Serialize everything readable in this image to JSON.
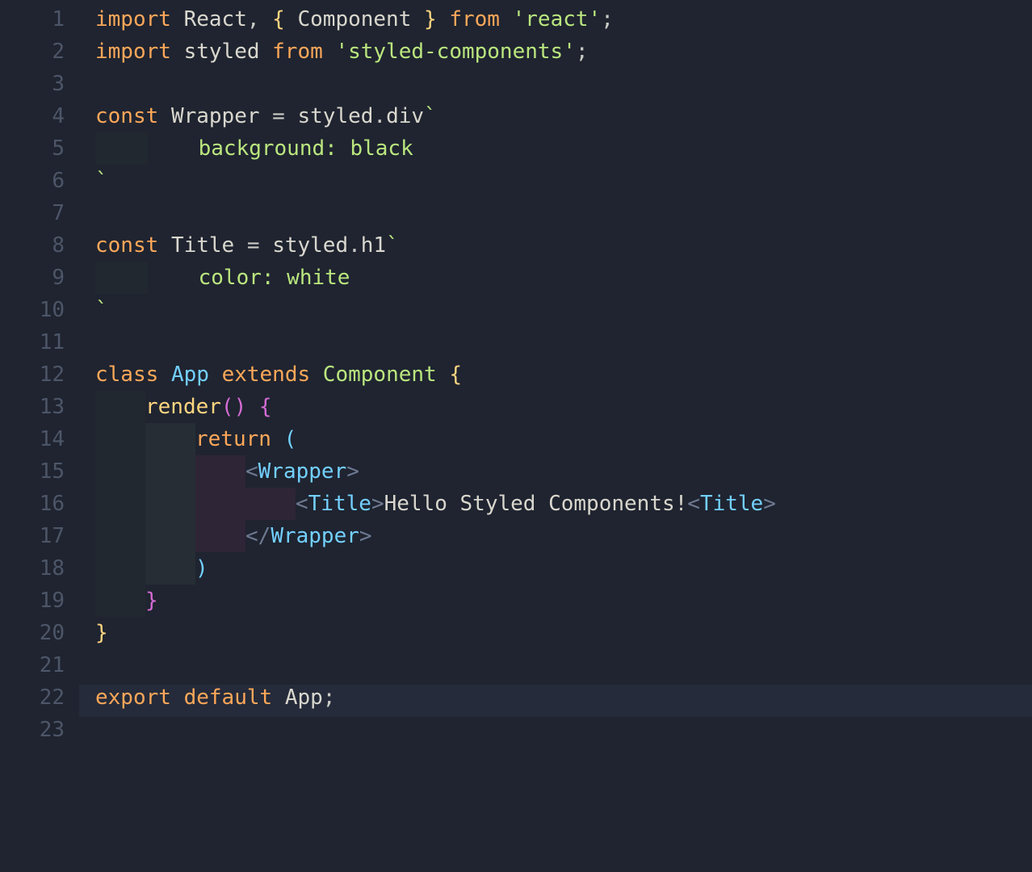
{
  "line_numbers": [
    "1",
    "2",
    "3",
    "4",
    "5",
    "6",
    "7",
    "8",
    "9",
    "10",
    "11",
    "12",
    "13",
    "14",
    "15",
    "16",
    "17",
    "18",
    "19",
    "20",
    "21",
    "22",
    "23"
  ],
  "tokens": {
    "l1": {
      "kw1": "import",
      "id1": "React",
      "punc1": ",",
      "brace1": "{",
      "id2": "Component",
      "brace2": "}",
      "kw2": "from",
      "str": "'react'",
      "semi": ";"
    },
    "l2": {
      "kw1": "import",
      "id1": "styled",
      "kw2": "from",
      "str": "'styled-components'",
      "semi": ";"
    },
    "l4": {
      "kw": "const",
      "id": "Wrapper",
      "eq": "=",
      "obj": "styled",
      "dot": ".",
      "prop": "div",
      "bt": "`"
    },
    "l5": {
      "body": "    background: black"
    },
    "l6": {
      "bt": "`"
    },
    "l8": {
      "kw": "const",
      "id": "Title",
      "eq": "=",
      "obj": "styled",
      "dot": ".",
      "prop": "h1",
      "bt": "`"
    },
    "l9": {
      "body": "    color: white"
    },
    "l10": {
      "bt": "`"
    },
    "l12": {
      "kw1": "class",
      "name": "App",
      "kw2": "extends",
      "sup": "Component",
      "brace": "{"
    },
    "l13": {
      "fn": "render",
      "paren": "()",
      "brace": "{"
    },
    "l14": {
      "kw": "return",
      "paren": "("
    },
    "l15": {
      "open": "<",
      "tag": "Wrapper",
      "close": ">"
    },
    "l16": {
      "open1": "<",
      "tag1": "Title",
      "close1": ">",
      "text": "Hello Styled Components!",
      "open2": "<",
      "tag2": "Title",
      "close2": ">"
    },
    "l17": {
      "open": "</",
      "tag": "Wrapper",
      "close": ">"
    },
    "l18": {
      "paren": ")"
    },
    "l19": {
      "brace": "}"
    },
    "l20": {
      "brace": "}"
    },
    "l22": {
      "kw1": "export",
      "kw2": "default",
      "id": "App",
      "semi": ";"
    }
  }
}
